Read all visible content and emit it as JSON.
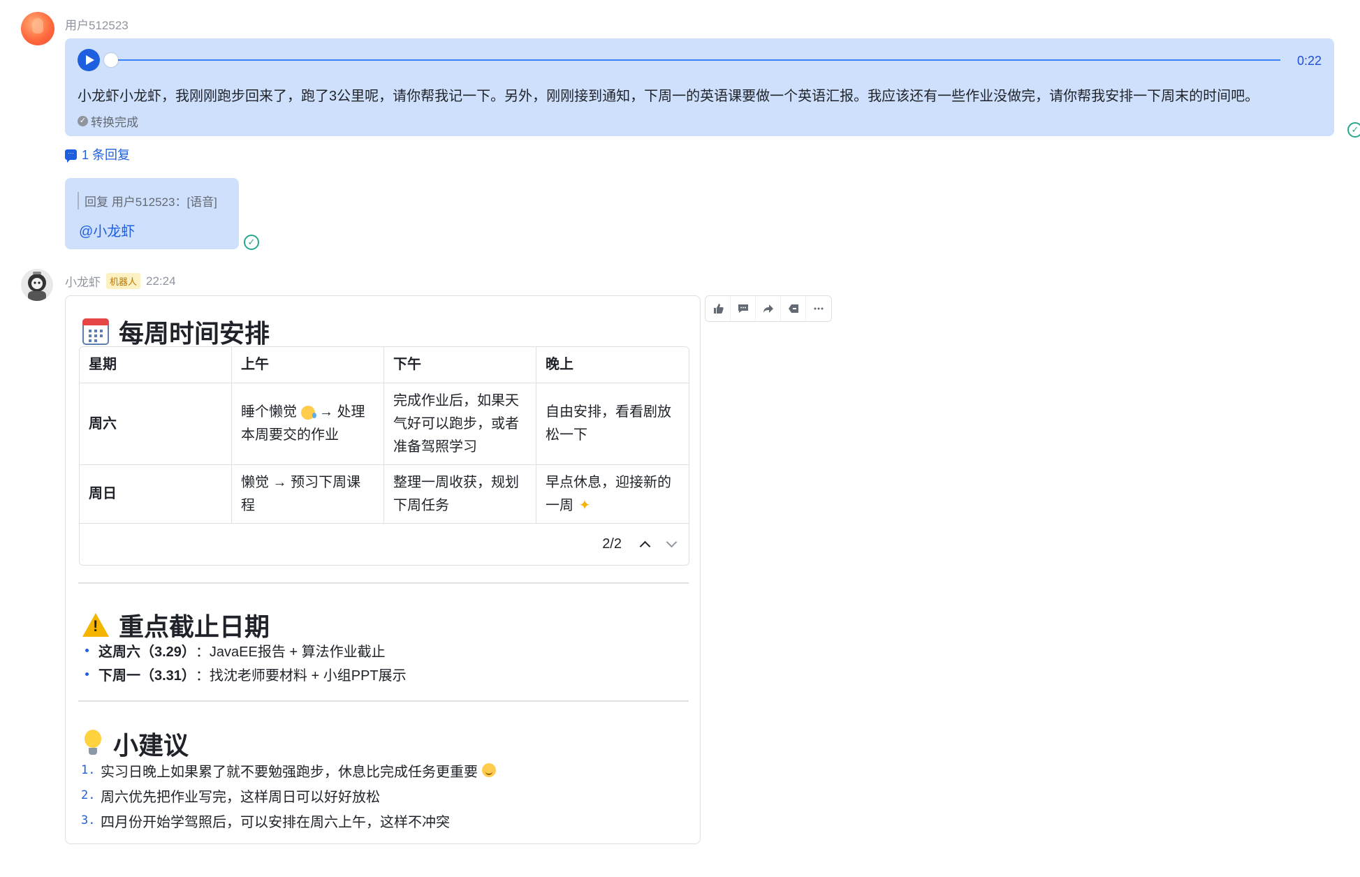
{
  "message1": {
    "sender": "用户512523",
    "duration": "0:22",
    "transcript": "小龙虾小龙虾，我刚刚跑步回来了，跑了3公里呢，请你帮我记一下。另外，刚刚接到通知，下周一的英语课要做一个英语汇报。我应该还有一些作业没做完，请你帮我安排一下周末的时间吧。",
    "status": "转换完成",
    "reply_count": "1 条回复"
  },
  "message2": {
    "quote": "回复 用户512523：[语音]",
    "mention": "@小龙虾"
  },
  "bot": {
    "name": "小龙虾",
    "badge": "机器人",
    "time": "22:24"
  },
  "card": {
    "schedule_title": "每周时间安排",
    "table": {
      "headers": [
        "星期",
        "上午",
        "下午",
        "晚上"
      ],
      "rows": [
        [
          "周六",
          "睡个懒觉",
          "→ 处理本周要交的作业",
          "完成作业后，如果天气好可以跑步，或者准备驾照学习",
          "自由安排，看看剧放松一下"
        ],
        [
          "周日",
          "懒觉 → 预习下周课程",
          "整理一周收获，规划下周任务",
          "早点休息，迎接新的一周"
        ]
      ],
      "pager": "2/2"
    },
    "deadline_title": "重点截止日期",
    "deadlines": [
      {
        "label": "这周六（3.29）",
        "text": "：JavaEE报告 + 算法作业截止"
      },
      {
        "label": "下周一（3.31）",
        "text": "：找沈老师要材料 + 小组PPT展示"
      }
    ],
    "tips_title": "小建议",
    "tips": [
      {
        "num": "1.",
        "text": "实习日晚上如果累了就不要勉强跑步，休息比完成任务更重要"
      },
      {
        "num": "2.",
        "text": "周六优先把作业写完，这样周日可以好好放松"
      },
      {
        "num": "3.",
        "text": "四月份开始学驾照后，可以安排在周六上午，这样不冲突"
      }
    ]
  },
  "toolbar": {
    "icons": [
      "thumbs-up-icon",
      "comment-icon",
      "forward-icon",
      "tag-icon",
      "more-icon"
    ]
  },
  "colors": {
    "bubble": "#cfe0fd",
    "accent": "#1e5fe0",
    "read": "#27a88c"
  }
}
